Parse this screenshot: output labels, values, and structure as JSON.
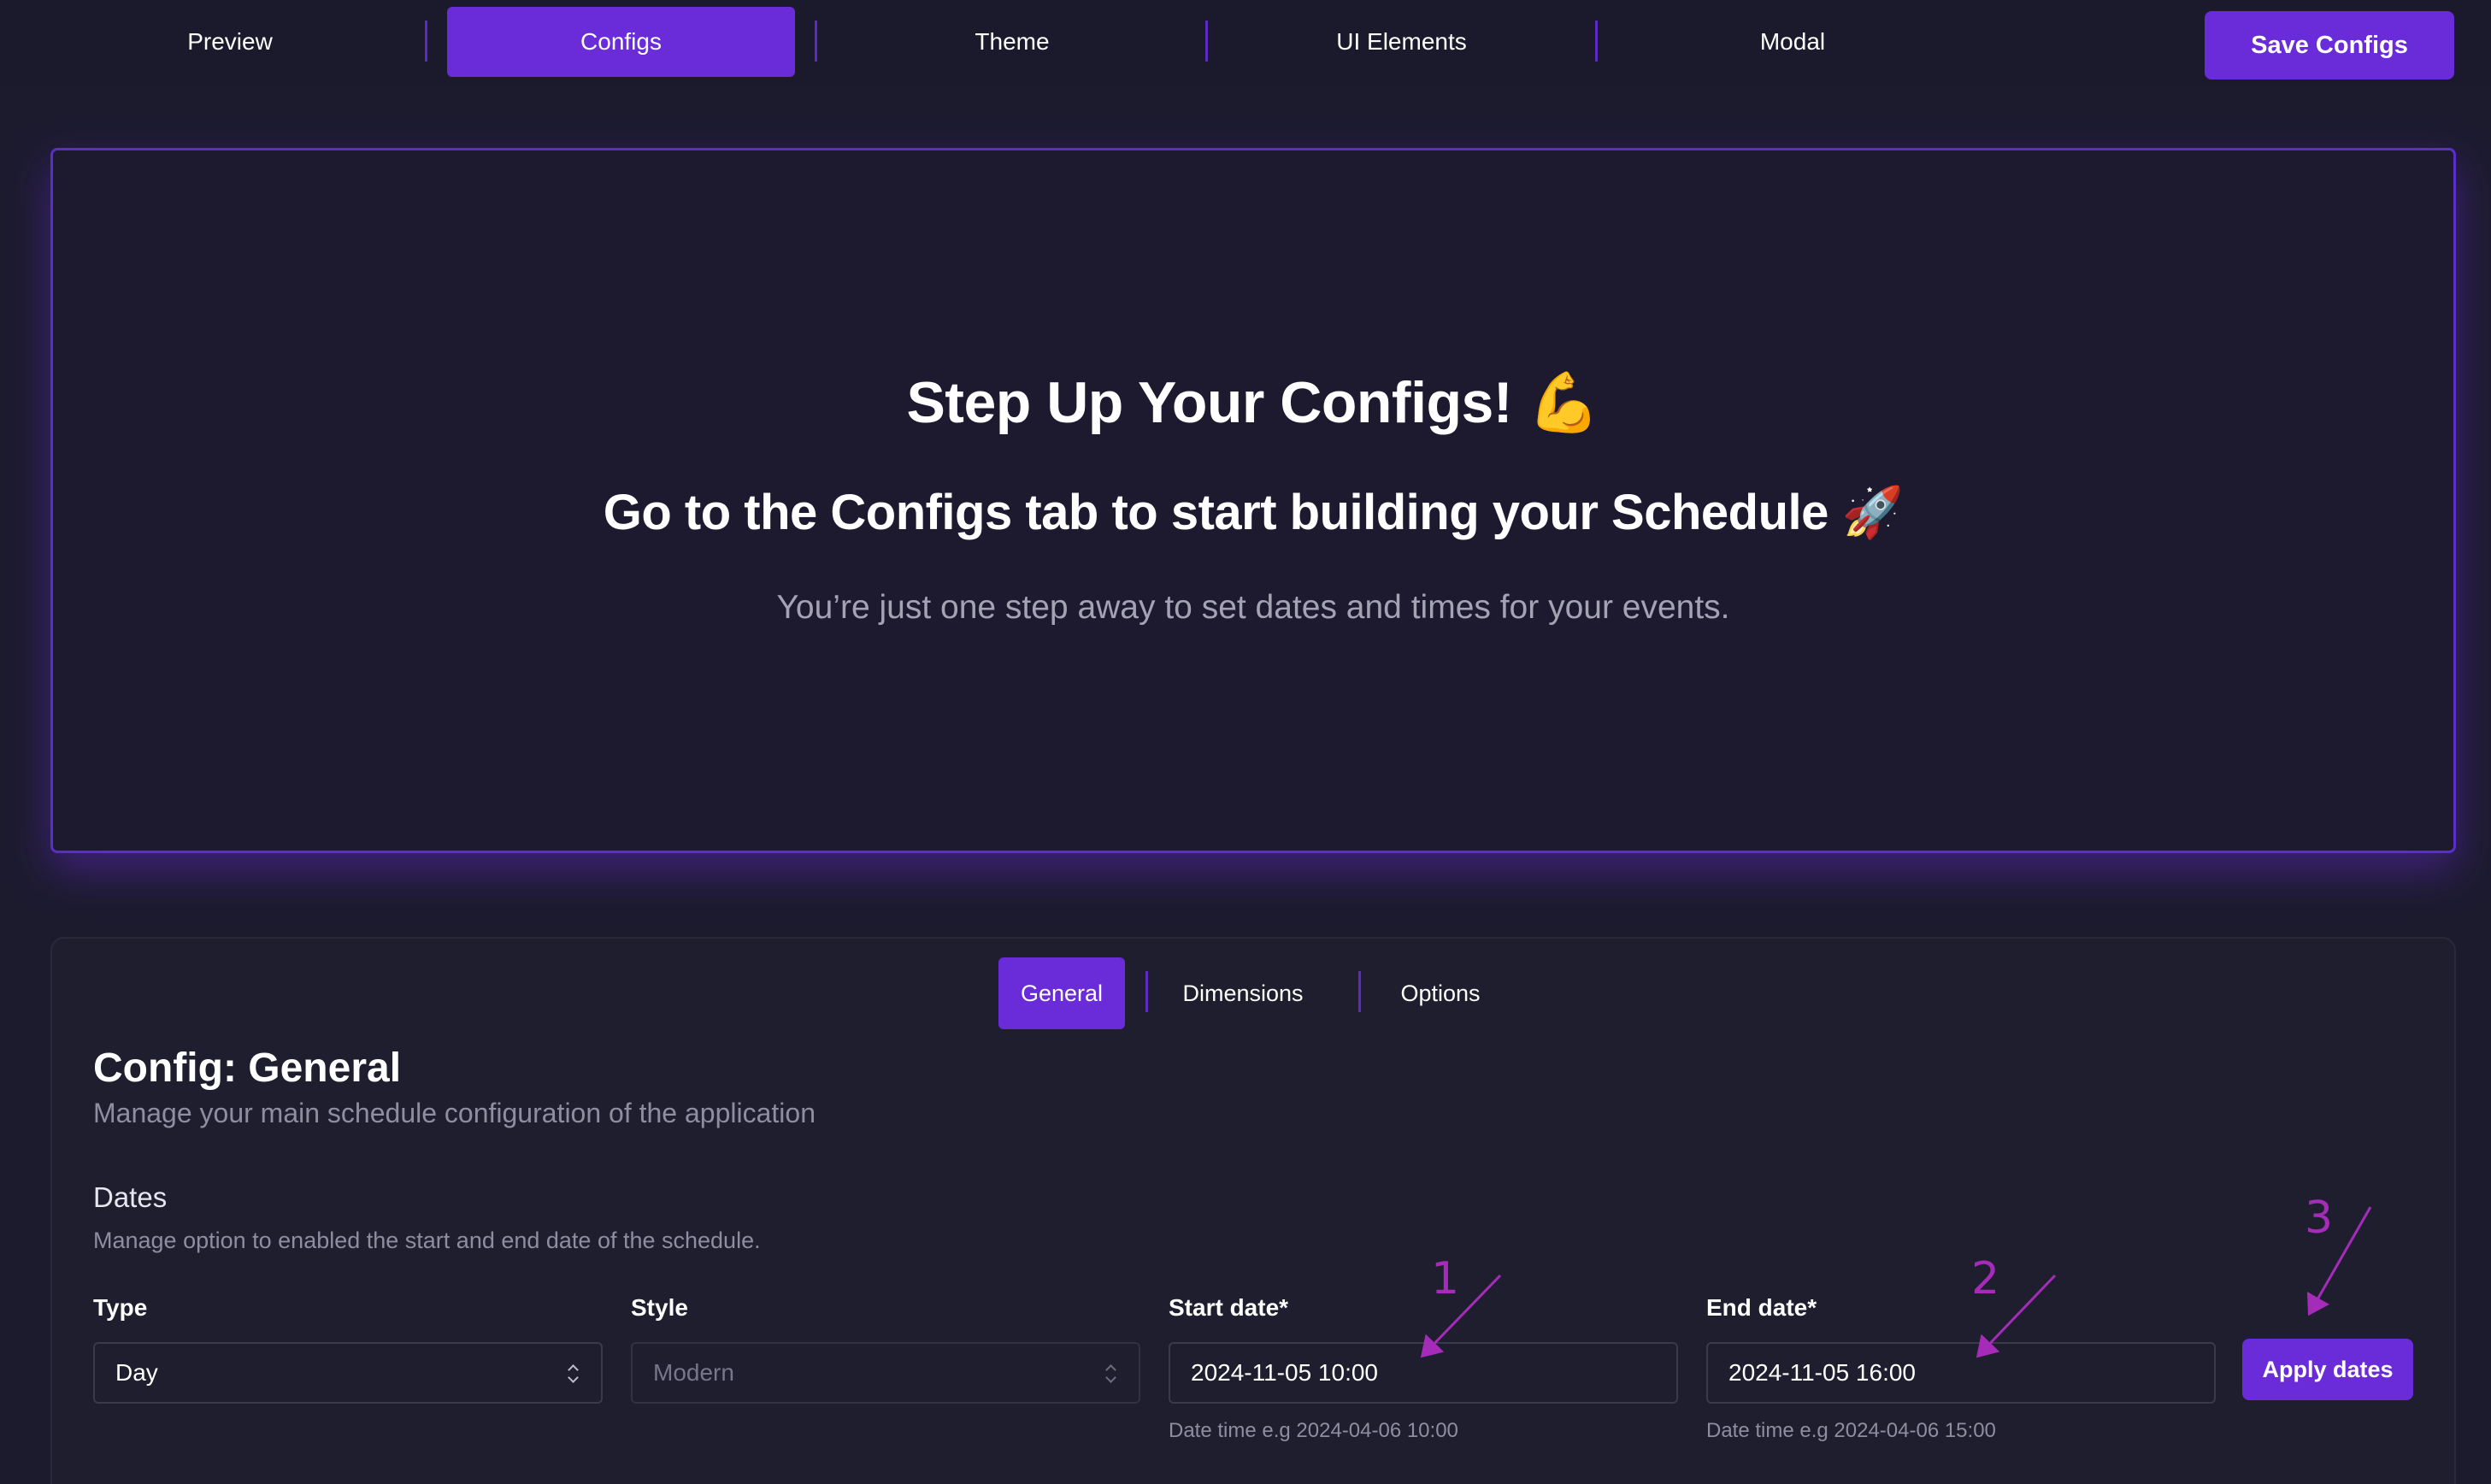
{
  "topnav": {
    "tabs": [
      {
        "label": "Preview"
      },
      {
        "label": "Configs"
      },
      {
        "label": "Theme"
      },
      {
        "label": "UI Elements"
      },
      {
        "label": "Modal"
      }
    ],
    "active_tab": "Configs",
    "save_label": "Save Configs"
  },
  "hero": {
    "title": "Step Up Your Configs! 💪",
    "subtitle": "Go to the Configs tab to start building your Schedule 🚀",
    "description": "You’re just one step away to set dates and times for your events."
  },
  "config": {
    "subtabs": [
      {
        "label": "General"
      },
      {
        "label": "Dimensions"
      },
      {
        "label": "Options"
      }
    ],
    "active_subtab": "General",
    "title": "Config: General",
    "description": "Manage your main schedule configuration of the application",
    "section": {
      "title": "Dates",
      "description": "Manage option to enabled the start and end date of the schedule."
    },
    "fields": {
      "type": {
        "label": "Type",
        "value": "Day"
      },
      "style": {
        "label": "Style",
        "value": "Modern"
      },
      "start_date": {
        "label": "Start date*",
        "value": "2024-11-05 10:00",
        "hint": "Date time e.g 2024-04-06 10:00"
      },
      "end_date": {
        "label": "End date*",
        "value": "2024-11-05 16:00",
        "hint": "Date time e.g 2024-04-06 15:00"
      }
    },
    "apply_label": "Apply dates"
  },
  "annotations": [
    "1",
    "2",
    "3"
  ],
  "colors": {
    "accent": "#6a2bd9",
    "background": "#1c1b2e",
    "annotation": "#a52cb8"
  }
}
